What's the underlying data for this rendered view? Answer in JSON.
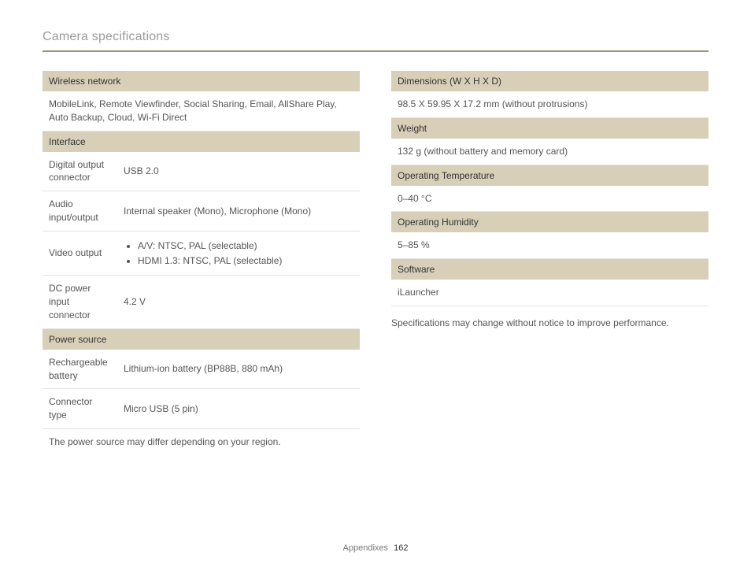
{
  "header": {
    "title": "Camera specifications"
  },
  "left": {
    "sections": [
      {
        "header": "Wireless network",
        "full_rows": [
          "MobileLink, Remote Viewfinder, Social Sharing, Email, AllShare Play, Auto Backup, Cloud, Wi-Fi Direct"
        ]
      },
      {
        "header": "Interface",
        "rows": [
          {
            "label": "Digital output connector",
            "value": "USB 2.0"
          },
          {
            "label": "Audio input/output",
            "value": "Internal speaker (Mono), Microphone (Mono)"
          },
          {
            "label": "Video output",
            "list": [
              "A/V: NTSC, PAL (selectable)",
              "HDMI 1.3: NTSC, PAL (selectable)"
            ]
          },
          {
            "label": "DC power input connector",
            "value": "4.2 V"
          }
        ]
      },
      {
        "header": "Power source",
        "rows": [
          {
            "label": "Rechargeable battery",
            "value": "Lithium-ion battery (BP88B, 880 mAh)"
          },
          {
            "label": "Connector type",
            "value": "Micro USB (5 pin)"
          }
        ],
        "note": "The power source may differ depending on your region."
      }
    ]
  },
  "right": {
    "sections": [
      {
        "header": "Dimensions (W X H X D)",
        "full_rows": [
          "98.5 X 59.95 X 17.2 mm (without protrusions)"
        ]
      },
      {
        "header": "Weight",
        "full_rows": [
          "132 g (without battery and memory card)"
        ]
      },
      {
        "header": "Operating Temperature",
        "full_rows": [
          "0–40 °C"
        ]
      },
      {
        "header": "Operating Humidity",
        "full_rows": [
          "5–85 %"
        ]
      },
      {
        "header": "Software",
        "full_rows": [
          "iLauncher"
        ]
      }
    ],
    "footnote": "Specifications may change without notice to improve performance."
  },
  "footer": {
    "section": "Appendixes",
    "page": "162"
  }
}
